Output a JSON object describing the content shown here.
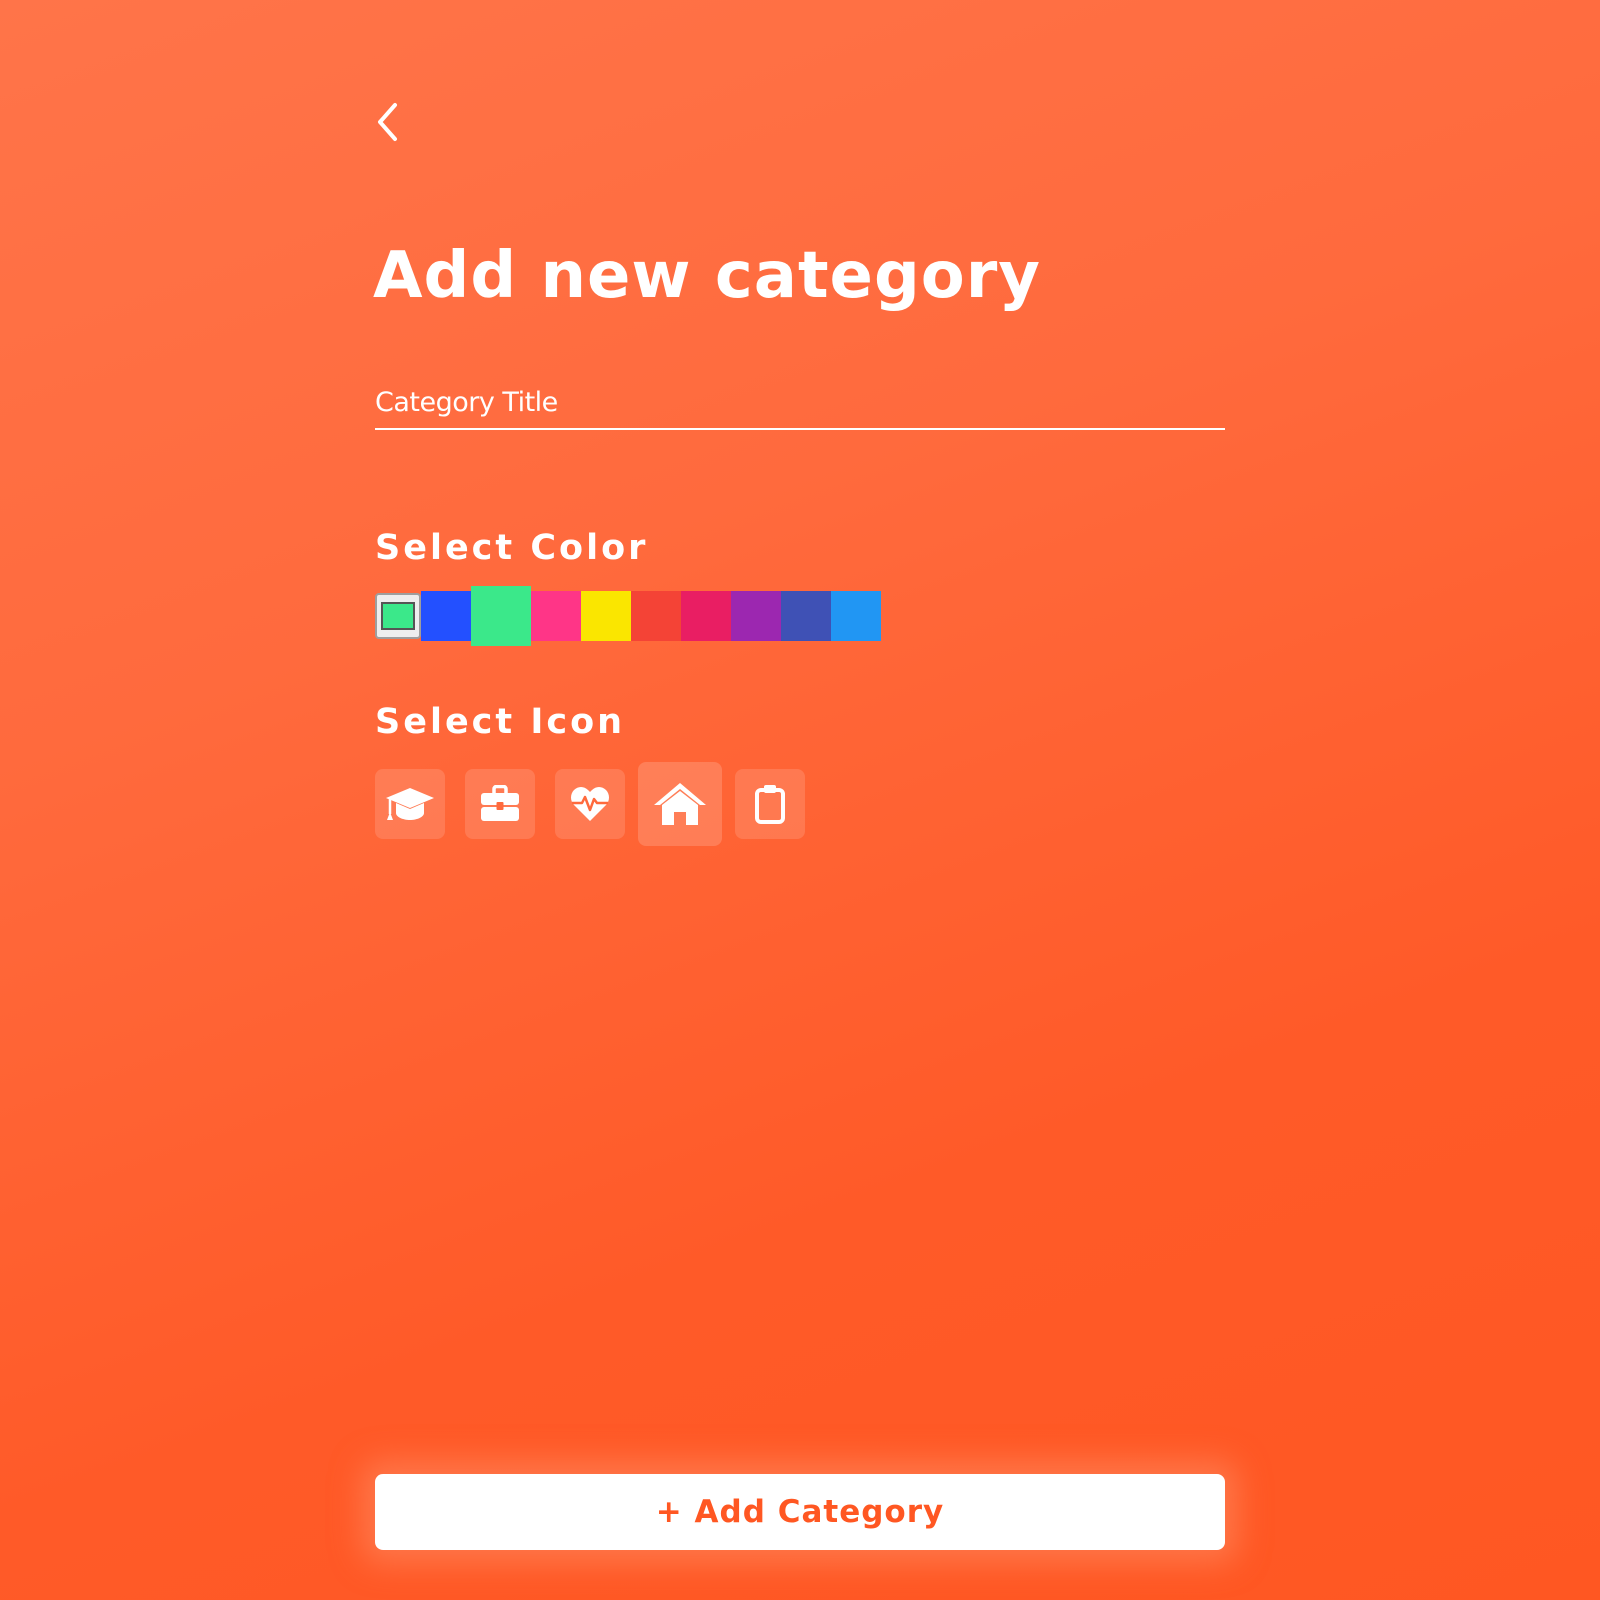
{
  "header": {
    "back_icon": "chevron-left-icon",
    "title": "Add new category"
  },
  "form": {
    "title_field": {
      "placeholder": "Category Title",
      "value": ""
    },
    "color_section": {
      "label": "Select Color",
      "picker_value": "#3be88a",
      "swatches": [
        "#2350ff",
        "#3be88a",
        "#ff3587",
        "#fae600",
        "#f44336",
        "#e91e63",
        "#9c27b0",
        "#3f51b5",
        "#2196f3"
      ],
      "selected_color": "#3be88a"
    },
    "icon_section": {
      "label": "Select Icon",
      "icons": [
        "graduation-cap-icon",
        "briefcase-icon",
        "heartbeat-icon",
        "home-icon",
        "clipboard-icon"
      ],
      "selected_icon": "home-icon"
    }
  },
  "actions": {
    "add_label": "+ Add Category"
  },
  "colors": {
    "background_start": "#ff7449",
    "background_end": "#ff5722",
    "accent": "#ff5722",
    "text": "#ffffff"
  }
}
